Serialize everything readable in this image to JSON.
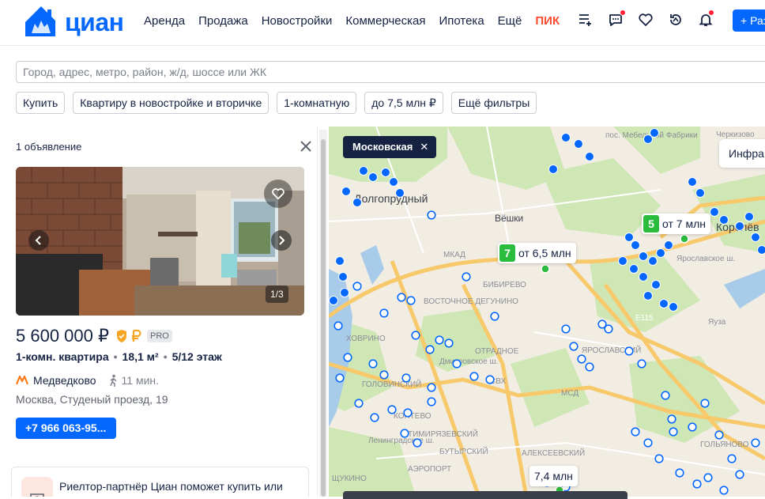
{
  "header": {
    "logo_text": "циан",
    "nav": [
      "Аренда",
      "Продажа",
      "Новостройки",
      "Коммерческая",
      "Ипотека",
      "Ещё"
    ],
    "pik": "ПИК",
    "place_button": "+ Раз"
  },
  "search": {
    "placeholder": "Город, адрес, метро, район, ж/д, шоссе или ЖК"
  },
  "filters": [
    "Купить",
    "Квартиру в новостройке и вторичке",
    "1-комнатную",
    "до 7,5 млн ₽",
    "Ещё фильтры"
  ],
  "listing": {
    "count": "1 объявление",
    "photo_counter": "1/3",
    "price": "5 600 000 ₽",
    "pro": "PRO",
    "rooms": "1-комн. квартира",
    "area": "18,1 м²",
    "floor": "5/12 этаж",
    "metro": "Медведково",
    "walk": "11 мин.",
    "address": "Москва, Студеный проезд, 19",
    "phone": "+7 966 063-95..."
  },
  "realtor": {
    "text": "Риелтор-партнёр Циан поможет купить или"
  },
  "map": {
    "chip": "Московская",
    "infra": "Инфра",
    "labels": [
      {
        "count": "7",
        "price": "от 6,5 млн"
      },
      {
        "count": "5",
        "price": "от 7 млн"
      },
      {
        "count": "",
        "price": "7,4 млн"
      }
    ],
    "places": [
      "Долгопрудный",
      "Вёшки",
      "МКАД",
      "БИБИРЕВО",
      "ВОСТОЧНОЕ ДЕГУНИНО",
      "ОТРАДНОЕ",
      "СВХ",
      "ХОВРИНО",
      "ГОЛОВИНСКИЙ",
      "КОПТЕВО",
      "ТИМИРЯЗЕВСКИЙ",
      "БУТЫРСКИЙ",
      "АЛЕКСЕЕВСКИЙ",
      "АЭРОПОРТ",
      "ЩУКИНО",
      "ЯРОСЛАВСКИЙ",
      "ГОЛЬЯНОВО",
      "Черкизово",
      "пос. Мебельной Фабрики",
      "Королёв",
      "E115",
      "МСД",
      "Ярославское ш.",
      "Дмитровское ш.",
      "Ленинградское ш.",
      "Яуза"
    ]
  },
  "colors": {
    "brand": "#0468ff",
    "pik": "#ff4c2e",
    "pin": "#0468ff",
    "label_badge": "#2bbb3d"
  }
}
